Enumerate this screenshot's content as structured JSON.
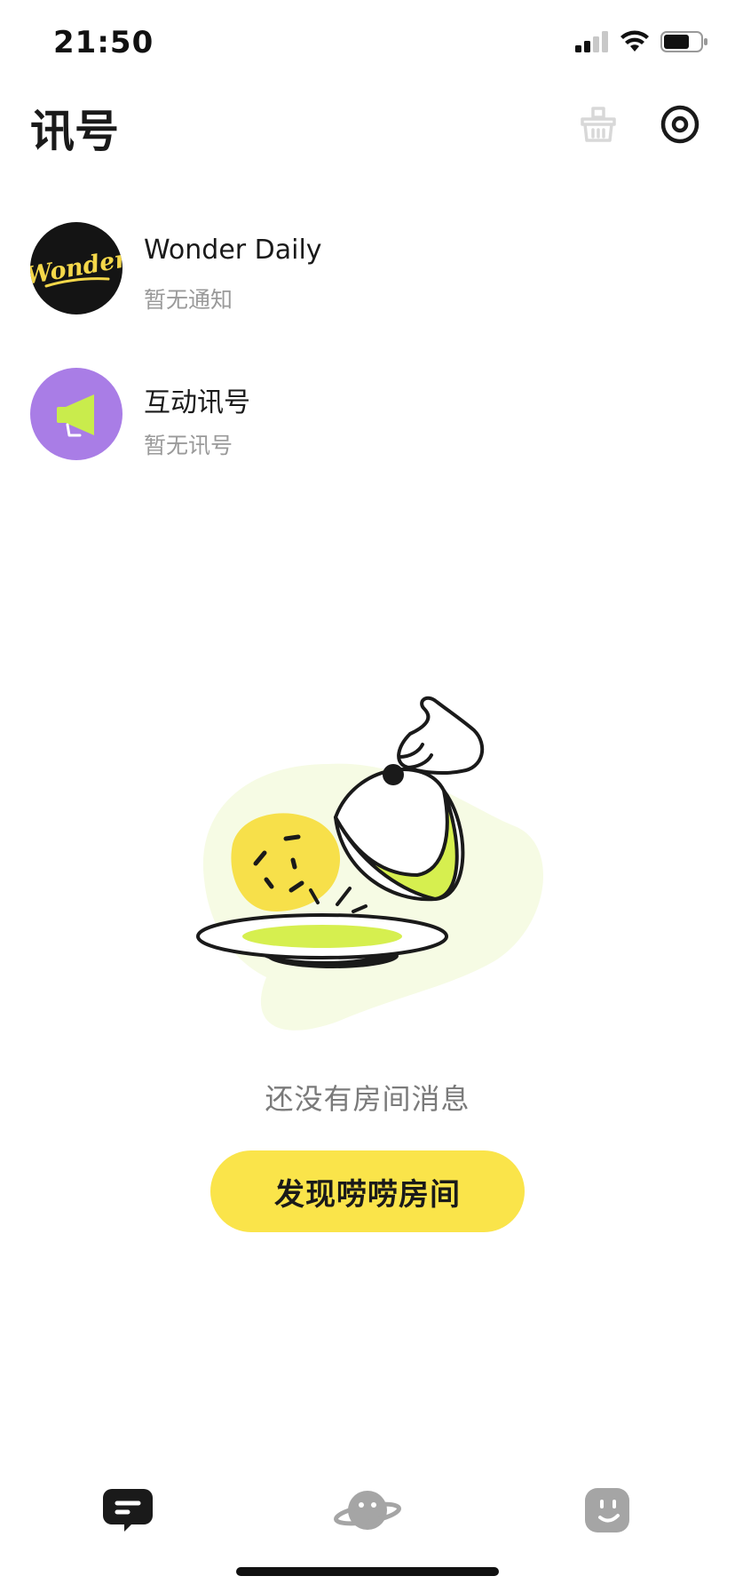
{
  "status_bar": {
    "time": "21:50"
  },
  "header": {
    "title": "讯号",
    "actions": [
      {
        "icon": "basket-icon",
        "color": "#d8d8d8"
      },
      {
        "icon": "settings-icon",
        "color": "#1a1a1a"
      }
    ]
  },
  "messages": [
    {
      "title": "Wonder Daily",
      "subtitle": "暂无通知",
      "avatar_text": "Wonder",
      "avatar_bg": "#141414",
      "avatar_fg": "#f5d84a"
    },
    {
      "title": "互动讯号",
      "subtitle": "暂无讯号",
      "avatar_icon": "megaphone-icon",
      "avatar_bg": "#a97de6"
    }
  ],
  "empty_state": {
    "text": "还没有房间消息",
    "button_label": "发现唠唠房间",
    "accent": "#fae44a",
    "lime": "#d6ef4f"
  },
  "tab_bar": {
    "tabs": [
      {
        "icon": "chat-icon",
        "active": true
      },
      {
        "icon": "planet-icon",
        "active": false
      },
      {
        "icon": "face-icon",
        "active": false
      }
    ]
  }
}
